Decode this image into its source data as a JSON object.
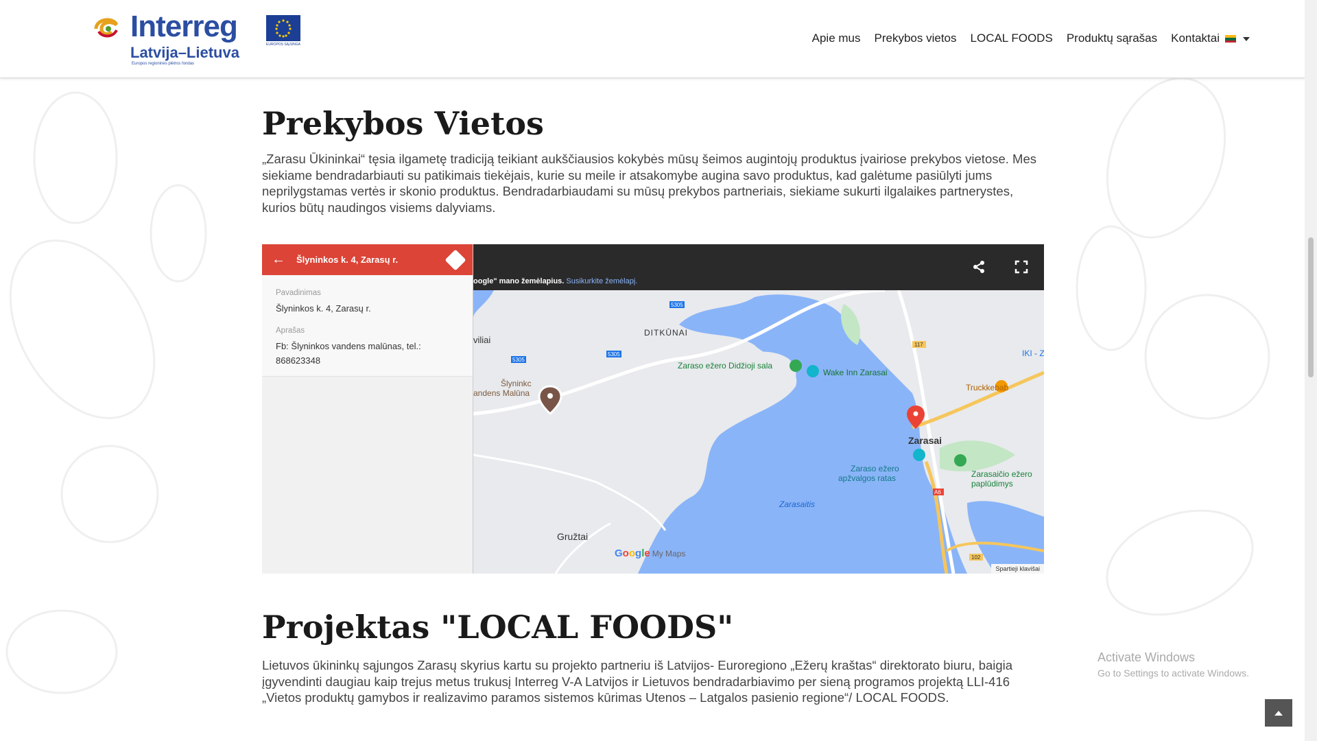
{
  "header": {
    "logo_main": "Interreg",
    "logo_sub": "Latvija–Lietuva",
    "logo_tiny": "Europos regioninės plėtros fondas",
    "eu_caption": "EUROPOS SĄJUNGA",
    "nav": [
      "Apie mus",
      "Prekybos vietos",
      "LOCAL FOODS",
      "Produktų sąrašas",
      "Kontaktai"
    ],
    "lang_flag": "lithuania-flag"
  },
  "section_prekybos": {
    "title": "Prekybos Vietos",
    "text": "„Zarasu Ūkininkai“ tęsia ilgametę tradiciją teikiant aukščiausios kokybės mūsų šeimos augintojų produktus įvairiose prekybos vietose. Mes siekiame bendradarbiauti su patikimais tiekėjais, kurie su meile ir atsakomybe augina savo produktus, kad galėtume pasiūlyti jums neprilygstamas vertės ir skonio produktus. Bendradarbiaudami su mūsų prekybos partneriais, siekiame sukurti ilgalaikes partnerystes, kurios būtų naudingos visiems dalyviams."
  },
  "map": {
    "panel_title": "Šlyninkos k. 4, Zarasų r.",
    "label_name": "Pavadinimas",
    "value_name": "Šlyninkos k. 4, Zarasų r.",
    "label_desc": "Aprašas",
    "value_desc": "Fb: Šlyninkos vandens malūnas, tel.: 868623348",
    "note_prefix": "oogle\" mano žemėlapius.",
    "note_link": "Susikurkite žemėlapį.",
    "labels": {
      "ditkunai": "DITKŪNAI",
      "viliai": "viliai",
      "slyninkos": "Šlyninkc",
      "slyninkos2": "andens Malūna",
      "didzioji": "Zaraso ežero Didžioji sala",
      "wake": "Wake Inn Zarasai",
      "truck": "Truckkebab",
      "iki": "IKI - Z",
      "zarasai": "Zarasai",
      "ratas": "Zaraso ežero",
      "ratas2": "apžvalgos ratas",
      "pludimys": "Zarasaičio ežero",
      "pludimys2": "paplūdimys",
      "zarasaitis": "Zarasaitis",
      "gruztai": "Gružtai",
      "r5305a": "5305",
      "r5305b": "5305",
      "r5305c": "5305",
      "r117": "117",
      "rA6": "A6",
      "r102": "102"
    },
    "google_my_maps": "My Maps",
    "attribution": "Spartieji klavišai"
  },
  "section_projektas": {
    "title": "Projektas \"LOCAL FOODS\"",
    "text": "Lietuvos ūkininkų sąjungos Zarasų skyrius kartu su projekto partneriu iš Latvijos- Euroregiono „Ežerų kraštas“ direktorato biuru, baigia įgyvendinti daugiau kaip trejus metus trukusį Interreg V-A Latvijos ir Lietuvos bendradarbiavimo per sieną programos projektą LLI-416 „Vietos produktų gamybos ir realizavimo paramos sistemos kūrimas Utenos – Latgalos pasienio regione“/ LOCAL FOODS."
  },
  "windows": {
    "activate_title": "Activate Windows",
    "activate_sub": "Go to Settings to activate Windows."
  }
}
